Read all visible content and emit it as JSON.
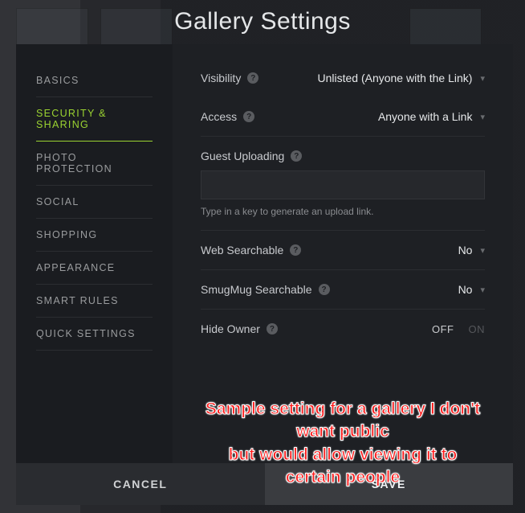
{
  "title": "Gallery Settings",
  "sidebar": {
    "items": [
      {
        "label": "BASICS",
        "active": false
      },
      {
        "label": "SECURITY & SHARING",
        "active": true
      },
      {
        "label": "PHOTO PROTECTION",
        "active": false
      },
      {
        "label": "SOCIAL",
        "active": false
      },
      {
        "label": "SHOPPING",
        "active": false
      },
      {
        "label": "APPEARANCE",
        "active": false
      },
      {
        "label": "SMART RULES",
        "active": false
      },
      {
        "label": "QUICK SETTINGS",
        "active": false
      }
    ]
  },
  "settings": {
    "visibility": {
      "label": "Visibility",
      "value": "Unlisted (Anyone with the Link)"
    },
    "access": {
      "label": "Access",
      "value": "Anyone with a Link"
    },
    "guestUploading": {
      "label": "Guest Uploading",
      "value": "",
      "placeholder": "",
      "hint": "Type in a key to generate an upload link."
    },
    "webSearchable": {
      "label": "Web Searchable",
      "value": "No"
    },
    "smugmugSearchable": {
      "label": "SmugMug Searchable",
      "value": "No"
    },
    "hideOwner": {
      "label": "Hide Owner",
      "off": "OFF",
      "on": "ON",
      "value": "OFF"
    }
  },
  "footer": {
    "cancel": "CANCEL",
    "save": "SAVE"
  },
  "helpGlyph": "?",
  "annotation": {
    "line1": "Sample setting for a gallery I don't want public",
    "line2": "but would allow viewing it to certain people"
  }
}
